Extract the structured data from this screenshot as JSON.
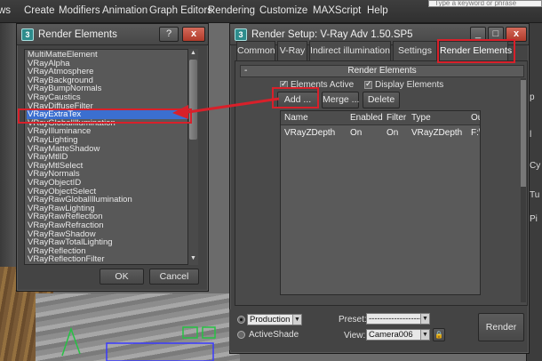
{
  "menubar": {
    "items": [
      "ws",
      "Create",
      "Modifiers",
      "Animation",
      "Graph Editors",
      "Rendering",
      "Customize",
      "MAXScript",
      "Help"
    ],
    "search_placeholder": "Type a keyword or phrase"
  },
  "right_panel": {
    "letters": [
      "p",
      "l",
      "Cy",
      "Tu",
      "Pi"
    ]
  },
  "render_elements_dialog": {
    "title": "Render Elements",
    "help_label": "?",
    "close_label": "x",
    "items": [
      "MultiMatteElement",
      "VRayAlpha",
      "VRayAtmosphere",
      "VRayBackground",
      "VRayBumpNormals",
      "VRayCaustics",
      "VRayDiffuseFilter",
      "VRayExtraTex",
      "VRayGlobalIllumination",
      "VRayIlluminance",
      "VRayLighting",
      "VRayMatteShadow",
      "VRayMtlID",
      "VRayMtlSelect",
      "VRayNormals",
      "VRayObjectID",
      "VRayObjectSelect",
      "VRayRawGlobalIllumination",
      "VRayRawLighting",
      "VRayRawReflection",
      "VRayRawRefraction",
      "VRayRawShadow",
      "VRayRawTotalLighting",
      "VRayReflection",
      "VRayReflectionFilter"
    ],
    "selected_item": "VRayExtraTex",
    "ok_label": "OK",
    "cancel_label": "Cancel",
    "scroll_up": "▲",
    "scroll_down": "▼"
  },
  "render_setup": {
    "title": "Render Setup: V-Ray Adv 1.50.SP5",
    "minimize_label": "_",
    "maximize_label": "□",
    "close_label": "x",
    "tabs": [
      "Common",
      "V-Ray",
      "Indirect illumination",
      "Settings",
      "Render Elements"
    ],
    "active_tab": "Render Elements",
    "rollout_title": "Render Elements",
    "rollout_toggle": "-",
    "elements_active_label": "Elements Active",
    "display_elements_label": "Display Elements",
    "add_label": "Add ...",
    "merge_label": "Merge ...",
    "delete_label": "Delete",
    "table_columns": [
      "Name",
      "Enabled",
      "Filter",
      "Type",
      "Ou"
    ],
    "table_rows": [
      {
        "name": "VRayZDepth",
        "enabled": "On",
        "filter": "On",
        "type": "VRayZDepth",
        "output": "F:\\"
      }
    ],
    "mode_production": "Production",
    "mode_activeshade": "ActiveShade",
    "preset_label": "Preset:",
    "preset_value": "-------------------",
    "view_label": "View:",
    "view_value": "Camera006",
    "lock_icon_glyph": "🔒",
    "render_label": "Render"
  },
  "colors": {
    "highlight": "#d8202a",
    "selection": "#3b6fd0"
  }
}
